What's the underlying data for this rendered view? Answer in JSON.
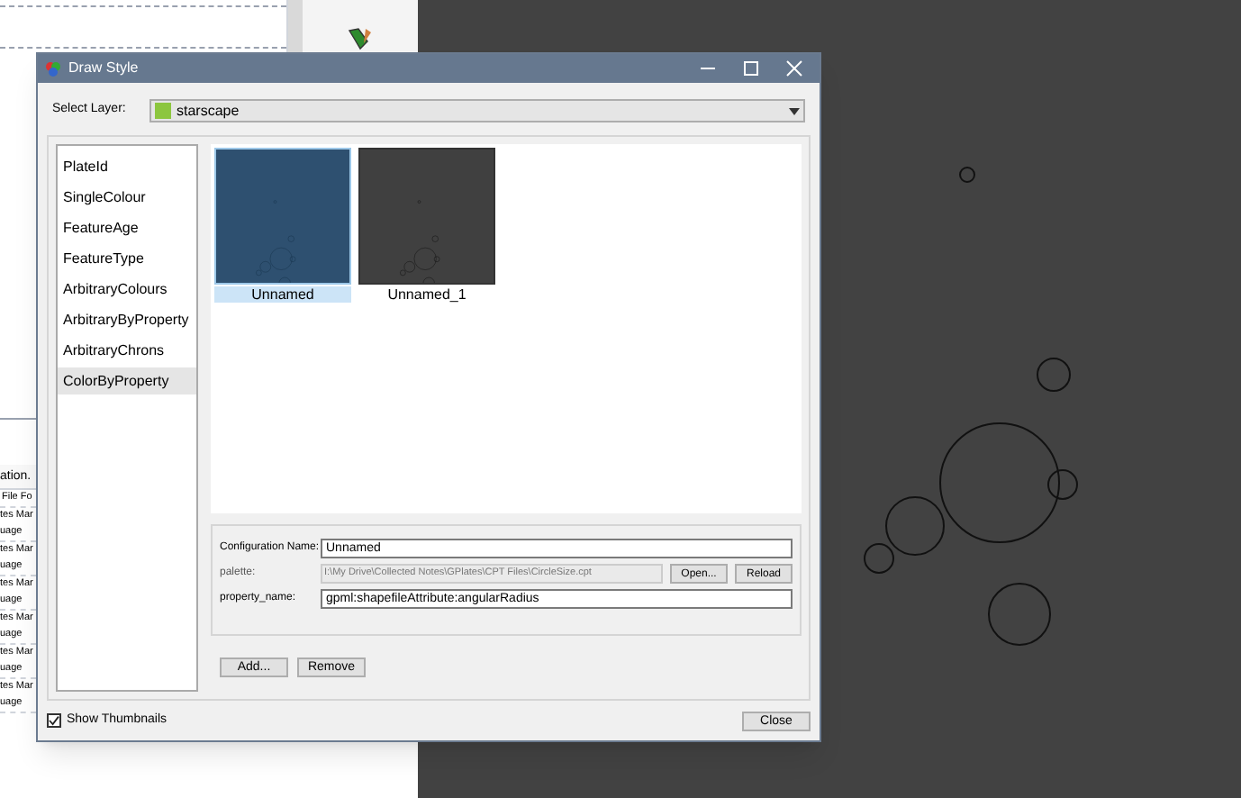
{
  "background_app": {
    "table": {
      "header": "ation.",
      "rows": [
        {
          "lines": [
            "File Fo"
          ]
        },
        {
          "lines": [
            "tes Mar",
            "uage"
          ]
        },
        {
          "lines": [
            "tes Mar",
            "uage"
          ]
        },
        {
          "lines": [
            "tes Mar",
            "uage"
          ]
        },
        {
          "lines": [
            "tes Mar",
            "uage"
          ]
        },
        {
          "lines": [
            "tes Mar",
            "uage"
          ]
        },
        {
          "lines": [
            "tes Mar",
            "uage"
          ]
        }
      ]
    }
  },
  "dialog": {
    "title": "Draw Style",
    "select_layer": {
      "label": "Select Layer:",
      "value": "starscape",
      "color": "#8cc63f"
    },
    "styles": [
      {
        "label": "PlateId",
        "selected": false
      },
      {
        "label": "SingleColour",
        "selected": false
      },
      {
        "label": "FeatureAge",
        "selected": false
      },
      {
        "label": "FeatureType",
        "selected": false
      },
      {
        "label": "ArbitraryColours",
        "selected": false
      },
      {
        "label": "ArbitraryByProperty",
        "selected": false
      },
      {
        "label": "ArbitraryChrons",
        "selected": false
      },
      {
        "label": "ColorByProperty",
        "selected": true
      }
    ],
    "thumbnails": [
      {
        "label": "Unnamed",
        "selected": true
      },
      {
        "label": "Unnamed_1",
        "selected": false
      }
    ],
    "configuration_name": {
      "label": "Configuration Name:",
      "value": "Unnamed"
    },
    "palette": {
      "label": "palette:",
      "value": "I:\\My Drive\\Collected Notes\\GPlates\\CPT Files\\CircleSize.cpt",
      "disabled": true,
      "buttons": [
        "Open...",
        "Reload"
      ]
    },
    "property_name": {
      "label": "property_name:",
      "value": "gpml:shapefileAttribute:angularRadius"
    },
    "buttons": [
      "Add...",
      "Remove"
    ],
    "show_thumbnails": {
      "label": "Show Thumbnails",
      "checked": true
    },
    "close": "Close"
  }
}
